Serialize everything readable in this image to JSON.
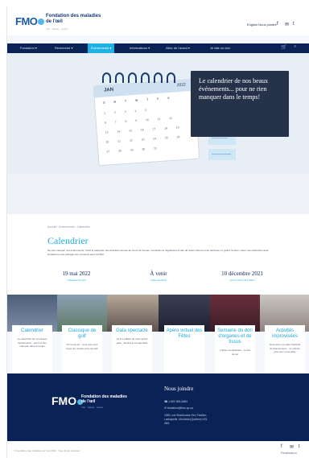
{
  "header": {
    "logo": "FMO",
    "org_name": "Fondation des maladies de l'œil",
    "org_tagline": "Voir · Savoir · Guérir",
    "lang_links": "English  Nous joindre",
    "social": [
      "f",
      "✉",
      "t"
    ]
  },
  "nav": {
    "items": [
      {
        "label": "Fondation ▾",
        "active": false
      },
      {
        "label": "Recherche ▾",
        "active": false
      },
      {
        "label": "Événements ▾",
        "active": true
      },
      {
        "label": "Informations ▾",
        "active": false
      },
      {
        "label": "Allez de l'avant ▾",
        "active": false
      },
      {
        "label": "Je fais un don",
        "active": false
      }
    ],
    "icons": [
      "cart-icon",
      "search-icon"
    ]
  },
  "hero": {
    "callout": "Le calendrier de nos beaux événements... pour ne rien manquer dans le temps!",
    "calendar_month": "JAN",
    "calendar_year": "2022",
    "calendar_weekdays": "S M T W T F S",
    "calendar_rows": [
      "1 2 3 4 5",
      "6 7 8 9 10 11 12",
      "13 14 15 16 17 18 19",
      "20 21 22 23 24 25 26",
      "27 28 29 30 31"
    ]
  },
  "content": {
    "breadcrumb": "Accueil  ›  Événements  ›  Calendrier",
    "title": "Calendrier",
    "intro": "Ne pas manquer nos événements ! Voici le calendrier des activités prévues au cours de l'année. Consultez-le régulièrement afin de rester informé et de participer en grand nombre. Nous vous attendons avec impatience pour partager ces moments avec la FMO.",
    "events": [
      {
        "date": "19 mai 2022",
        "sub": "Classique de golf"
      },
      {
        "date": "À venir",
        "sub": "Gala spectacle"
      },
      {
        "date": "10 décembre 2021",
        "sub": "Apéro virtuel des Fêtes"
      }
    ]
  },
  "cards": [
    {
      "title": "Calendrier",
      "text": "Le calendrier de nos beaux événements... pour ne rien manquer dans le temps"
    },
    {
      "title": "Classique de golf",
      "text": "On remet ça... pour que vous soyez au rendez-vous cet été!"
    },
    {
      "title": "Gala spectacle",
      "text": "La 1re édition de notre grand gala... bientôt à nos agendas"
    },
    {
      "title": "Apéro virtuel des Fêtes",
      "text": ""
    },
    {
      "title": "Semaine du don d'organes et de tissus",
      "text": "L'ultime compassion... le don de soi"
    },
    {
      "title": "Activités improvisées",
      "text": "Vous avez une idée d'activité de financement... un outil de plus pour nous aider"
    }
  ],
  "footer": {
    "logo": "FMO",
    "org_name": "Fondation des maladies de l'œil",
    "org_tagline": "Voir · Savoir · Guérir",
    "contact_title": "Nous joindre",
    "phone": "☎  1 800 363-0684",
    "email": "✉  fondation@fmo.qc.ca",
    "address": "1560, rue Sherbrooke Est, Pavillon Lachapelle, Montréal (Québec) H2L 4M1",
    "copyright": "© Fondation des maladies de l'œil 2022 · Tous droits réservés",
    "social": [
      "f",
      "✉",
      "t"
    ],
    "credit": "Réalisation"
  },
  "colors": {
    "navy": "#0b2257",
    "accent": "#1db2e3",
    "callout": "#26324a"
  }
}
